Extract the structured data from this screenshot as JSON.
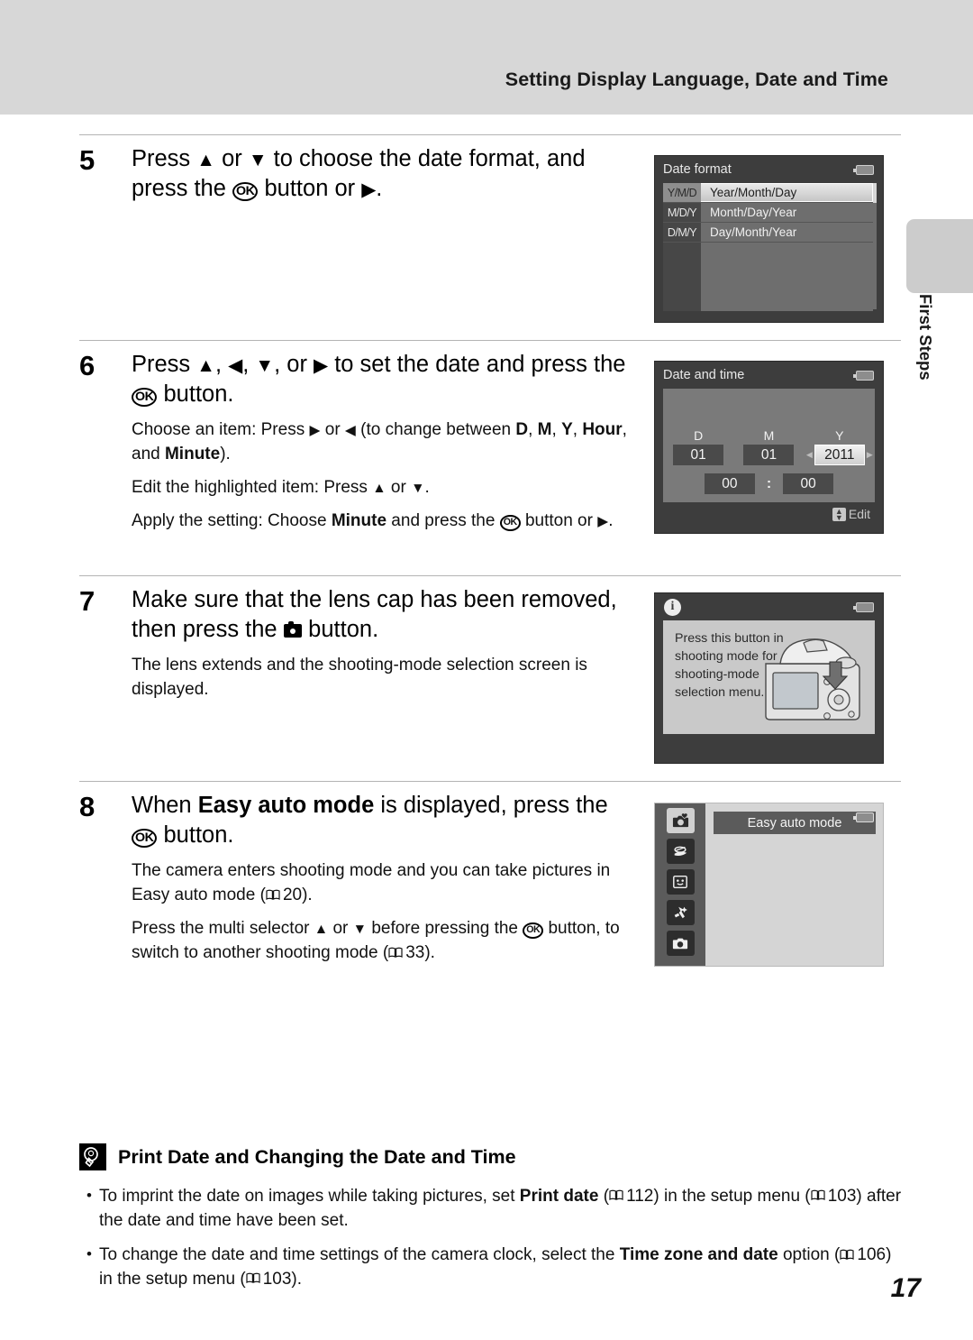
{
  "header": {
    "title": "Setting Display Language, Date and Time"
  },
  "side_tab": {
    "label": "First Steps"
  },
  "page_number": "17",
  "steps": [
    {
      "number": "5",
      "heading_parts": [
        "Press ",
        "UP",
        " or ",
        "DOWN",
        " to choose the date format, and press the ",
        "OK",
        " button or ",
        "RIGHT",
        "."
      ],
      "body": []
    },
    {
      "number": "6",
      "heading_parts": [
        "Press ",
        "UP",
        ", ",
        "LEFT",
        ", ",
        "DOWN",
        ", or ",
        "RIGHT",
        " to set the date and press the ",
        "OK",
        " button."
      ],
      "body": [
        "Choose an item: Press ▶ or ◀ (to change between D, M, Y, Hour, and Minute).",
        "Edit the highlighted item: Press ▲ or ▼.",
        "Apply the setting: Choose Minute and press the OK button or ▶."
      ]
    },
    {
      "number": "7",
      "heading_parts": [
        "Make sure that the lens cap has been removed, then press the ",
        "CAMERA",
        " button."
      ],
      "body": [
        "The lens extends and the shooting-mode selection screen is displayed."
      ]
    },
    {
      "number": "8",
      "heading_parts": [
        "When ",
        "Easy auto mode",
        " is displayed, press the ",
        "OK",
        " button."
      ],
      "body": [
        "The camera enters shooting mode and you can take pictures in Easy auto mode (□ 20).",
        "Press the multi selector ▲ or ▼ before pressing the OK button, to switch to another shooting mode (□ 33)."
      ]
    }
  ],
  "step5_text": {
    "line1_a": "Press ",
    "line1_b": " or ",
    "line1_c": " to choose the date format, and press the ",
    "line1_d": " button or ",
    "line1_e": "."
  },
  "step6_text": {
    "head_a": "Press ",
    "head_b": ", ",
    "head_c": ", ",
    "head_d": ", or ",
    "head_e": " to set the date and press the ",
    "head_f": " button.",
    "p1_a": "Choose an item: Press ",
    "p1_b": " or ",
    "p1_c": " (to change between ",
    "p1_d": "D",
    "p1_e": ", ",
    "p1_f": "M",
    "p1_g": ", ",
    "p1_h": "Y",
    "p1_i": ", ",
    "p1_j": "Hour",
    "p1_k": ", and ",
    "p1_l": "Minute",
    "p1_m": ").",
    "p2_a": "Edit the highlighted item: Press ",
    "p2_b": " or ",
    "p2_c": ".",
    "p3_a": "Apply the setting: Choose ",
    "p3_b": "Minute",
    "p3_c": " and press the ",
    "p3_d": " button or ",
    "p3_e": "."
  },
  "step7_text": {
    "head_a": "Make sure that the lens cap has been removed, then press the ",
    "head_b": " button.",
    "p1": "The lens extends and the shooting-mode selection screen is displayed."
  },
  "step8_text": {
    "head_a": "When ",
    "head_b": "Easy auto mode",
    "head_c": " is displayed, press the ",
    "head_d": " button.",
    "p1_a": "The camera enters shooting mode and you can take pictures in Easy auto mode (",
    "p1_page": "20",
    "p1_b": ").",
    "p2_a": "Press the multi selector ",
    "p2_b": " or ",
    "p2_c": " before pressing the ",
    "p2_d": " button, to switch to another shooting mode (",
    "p2_page": "33",
    "p2_e": ")."
  },
  "lcd_date_format": {
    "title": "Date format",
    "rows": [
      {
        "abbr": "Y/M/D",
        "name": "Year/Month/Day",
        "selected": true
      },
      {
        "abbr": "M/D/Y",
        "name": "Month/Day/Year",
        "selected": false
      },
      {
        "abbr": "D/M/Y",
        "name": "Day/Month/Year",
        "selected": false
      }
    ]
  },
  "lcd_date_time": {
    "title": "Date and time",
    "label_d": "D",
    "label_m": "M",
    "label_y": "Y",
    "value_d": "01",
    "value_m": "01",
    "value_y": "2011",
    "value_hour": "00",
    "colon": ":",
    "value_minute": "00",
    "footer_label": "Edit"
  },
  "lcd_info": {
    "icon": "info-icon",
    "text": "Press this button in shooting mode for shooting-mode selection menu."
  },
  "lcd_mode": {
    "banner": "Easy auto mode",
    "icons": [
      {
        "name": "easy-auto-mode-icon",
        "selected": true
      },
      {
        "name": "scene-mode-icon",
        "selected": false
      },
      {
        "name": "smart-portrait-mode-icon",
        "selected": false
      },
      {
        "name": "special-effects-mode-icon",
        "selected": false
      },
      {
        "name": "auto-mode-icon",
        "selected": false
      }
    ]
  },
  "note": {
    "title": "Print Date and Changing the Date and Time",
    "bullet": "•",
    "items": [
      {
        "a": "To imprint the date on images while taking pictures, set ",
        "bold": "Print date",
        "b": " (",
        "page1": "112",
        "c": ") in the setup menu (",
        "page2": "103",
        "d": ") after the date and time have been set."
      },
      {
        "a": "To change the date and time settings of the camera clock, select the ",
        "bold": "Time zone and date",
        "b": " option (",
        "page1": "106",
        "c": ") in the setup menu (",
        "page2": "103",
        "d": ")."
      }
    ]
  },
  "colors": {
    "header_band": "#d7d7d7",
    "lcd_frame": "#3d3d3d",
    "lcd_panel": "#7a7a7a",
    "highlight": "#e9e9e9"
  }
}
